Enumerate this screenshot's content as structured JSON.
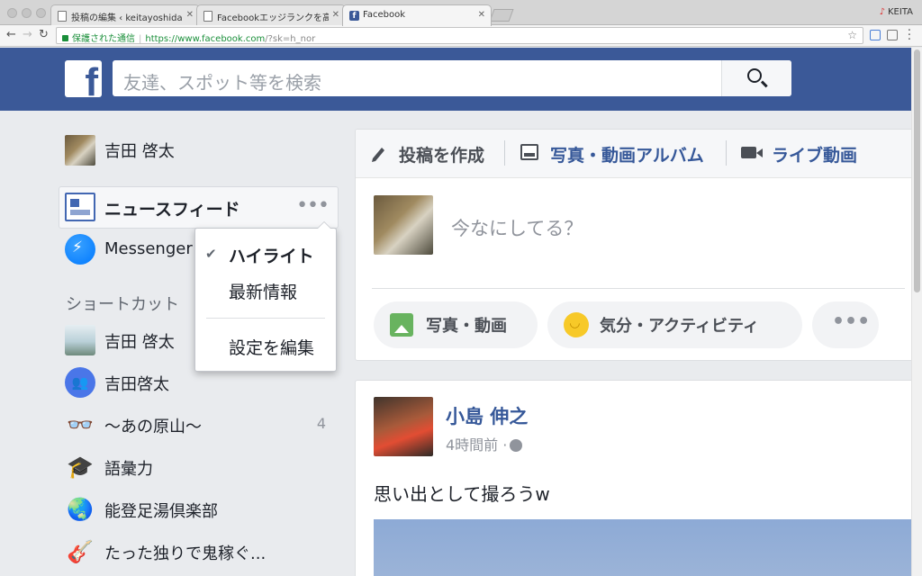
{
  "browser": {
    "tabs": [
      {
        "title": "投稿の編集 ‹ keitayoshida.com"
      },
      {
        "title": "Facebookエッジランクを高める"
      },
      {
        "title": "Facebook"
      }
    ],
    "profile_name": "KEITA",
    "address": {
      "security_label": "保護された通信",
      "url_host": "https://www.facebook.com",
      "url_path": "/?sk=h_nor"
    }
  },
  "fb": {
    "logo": "f",
    "search_placeholder": "友達、スポット等を検索"
  },
  "sidebar": {
    "user_name": "吉田 啓太",
    "newsfeed_label": "ニュースフィード",
    "messenger_label": "Messenger",
    "shortcuts_title": "ショートカット",
    "shortcuts": [
      {
        "label": "吉田 啓太",
        "count": ""
      },
      {
        "label": "吉田啓太",
        "count": ""
      },
      {
        "label": "〜あの原山〜",
        "count": "4"
      },
      {
        "label": "語彙力",
        "count": ""
      },
      {
        "label": "能登足湯倶楽部",
        "count": ""
      },
      {
        "label": "たった独りで鬼稼ぐ...",
        "count": ""
      }
    ]
  },
  "dropdown": {
    "items": [
      {
        "label": "ハイライト",
        "checked": true
      },
      {
        "label": "最新情報",
        "checked": false
      },
      {
        "label": "設定を編集",
        "checked": false
      }
    ]
  },
  "composer": {
    "tabs": [
      "投稿を作成",
      "写真・動画アルバム",
      "ライブ動画"
    ],
    "placeholder": "今なにしてる？",
    "actions": [
      "写真・動画",
      "気分・アクティビティ",
      "•••"
    ]
  },
  "post": {
    "author": "小島 伸之",
    "time": "4時間前 ·",
    "text": "思い出として撮ろうw"
  },
  "colors": {
    "fb_blue": "#3b5998",
    "link_blue": "#365899",
    "page_bg": "#e9ebee"
  }
}
